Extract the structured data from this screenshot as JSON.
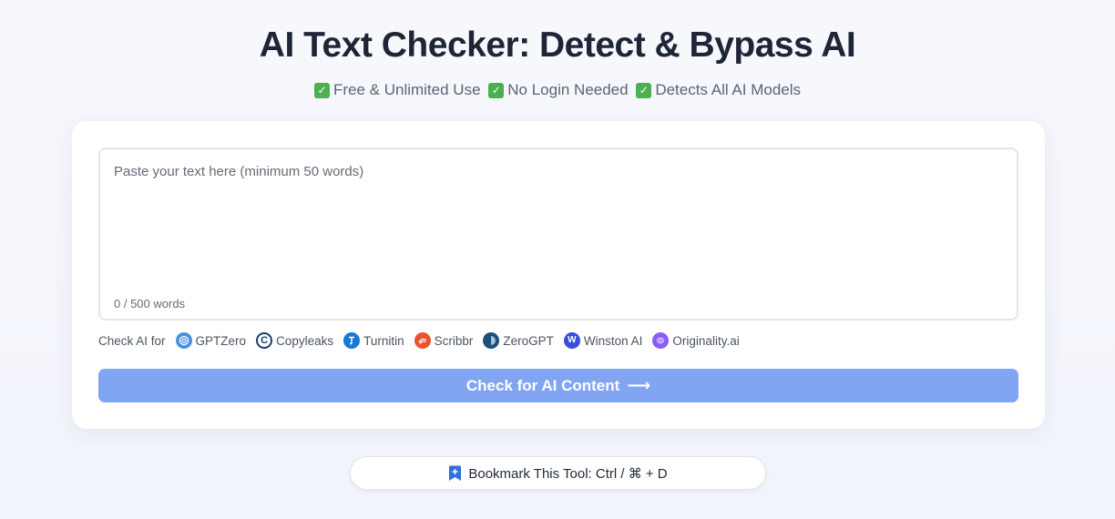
{
  "header": {
    "title": "AI Text Checker: Detect & Bypass AI",
    "features": [
      {
        "icon": "check-mark-icon",
        "label": "Free & Unlimited Use"
      },
      {
        "icon": "check-mark-icon",
        "label": "No Login Needed"
      },
      {
        "icon": "check-mark-icon",
        "label": "Detects All AI Models"
      }
    ]
  },
  "editor": {
    "placeholder": "Paste your text here (minimum 50 words)",
    "value": "",
    "word_count": "0 / 500 words"
  },
  "detectors": {
    "lead": "Check AI for",
    "items": [
      {
        "name": "GPTZero",
        "icon": "gptzero-icon",
        "color": "#4a90e2"
      },
      {
        "name": "Copyleaks",
        "icon": "copyleaks-icon",
        "color": "#1d3b6e"
      },
      {
        "name": "Turnitin",
        "icon": "turnitin-icon",
        "color": "#1778d6"
      },
      {
        "name": "Scribbr",
        "icon": "scribbr-icon",
        "color": "#e8542f"
      },
      {
        "name": "ZeroGPT",
        "icon": "zerogpt-icon",
        "color": "#1e4f7a"
      },
      {
        "name": "Winston AI",
        "icon": "winston-icon",
        "color": "#3b4fd8"
      },
      {
        "name": "Originality.ai",
        "icon": "originality-icon",
        "color": "#8b5cf6"
      }
    ]
  },
  "actions": {
    "check_label": "Check for AI Content",
    "check_arrow": "⟶",
    "bookmark_label": "Bookmark This Tool: Ctrl / ⌘ + D"
  },
  "colors": {
    "accent": "#82a5f3",
    "check_green": "#4caf50",
    "bookmark_blue": "#2f6fe0"
  }
}
